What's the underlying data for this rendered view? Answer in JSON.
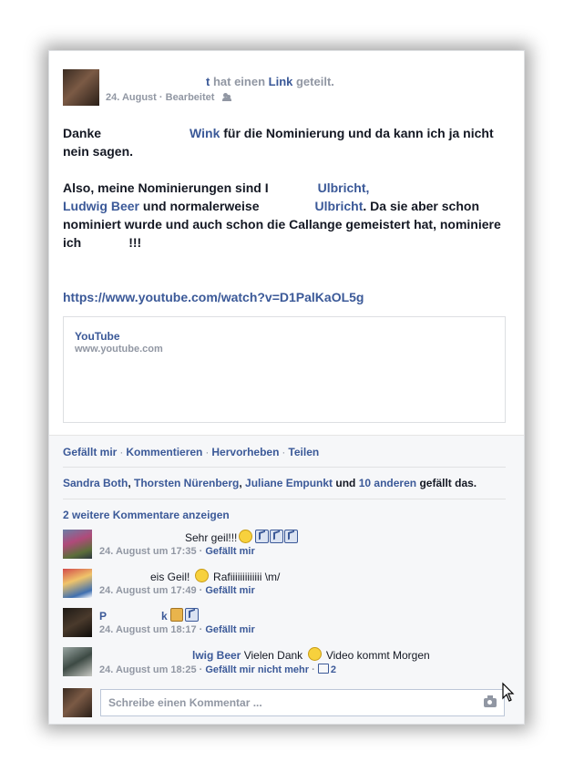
{
  "post": {
    "author_masked": "",
    "header_suffix_t": "t",
    "header_hat_einen": " hat einen ",
    "header_link": "Link",
    "header_geteilt": " geteilt.",
    "date": "24. August",
    "edited": "Bearbeitet",
    "text": {
      "p1_a": "Danke",
      "p1_name": "Wink",
      "p1_b": " für die Nominierung und da kann ich ja nicht nein sagen.",
      "p2_a": "Also, meine Nominierungen sind ",
      "p2_i": "I",
      "p2_name1": "Ulbricht,",
      "p2_name2": "Ludwig Beer",
      "p2_b": " und normalerweise",
      "p2_name3": "Ulbricht",
      "p2_c": ". Da sie aber schon nominiert wurde und auch schon die Callange gemeistert hat, nominiere ich",
      "p2_d": "!!!",
      "url": "https://www.youtube.com/watch?v=D1PalKaOL5g"
    },
    "preview": {
      "title": "YouTube",
      "domain": "www.youtube.com"
    }
  },
  "actions": {
    "like": "Gefällt mir",
    "comment": "Kommentieren",
    "highlight": "Hervorheben",
    "share": "Teilen",
    "sep": "·"
  },
  "likes": {
    "name1": "Sandra Both",
    "name2": "Thorsten Nürenberg",
    "name3": "Juliane Empunkt",
    "and": " und ",
    "others": "10 anderen",
    "suffix": " gefällt das."
  },
  "more_comments": "2 weitere Kommentare anzeigen",
  "comments": [
    {
      "text": "Sehr geil!!!",
      "time": "24. August um 17:35",
      "like_label": "Gefällt mir"
    },
    {
      "text": "eis Geil! ",
      "text2": " Rafiiiiiiiiiiiii \\m/",
      "time": "24. August um 17:49",
      "like_label": "Gefällt mir"
    },
    {
      "text_a": "P",
      "text_b": "k",
      "time": "24. August um 18:17",
      "like_label": "Gefällt mir"
    },
    {
      "text": "lwig Beer",
      "text2": " Vielen Dank ",
      "text3": " Video kommt Morgen",
      "time": "24. August um 18:25",
      "like_label": "Gefällt mir nicht mehr",
      "like_count": "2"
    }
  ],
  "compose": {
    "placeholder": "Schreibe einen Kommentar ..."
  },
  "colors": {
    "link": "#3b5998",
    "meta": "#9197a3",
    "footer_bg": "#f6f7f9"
  }
}
